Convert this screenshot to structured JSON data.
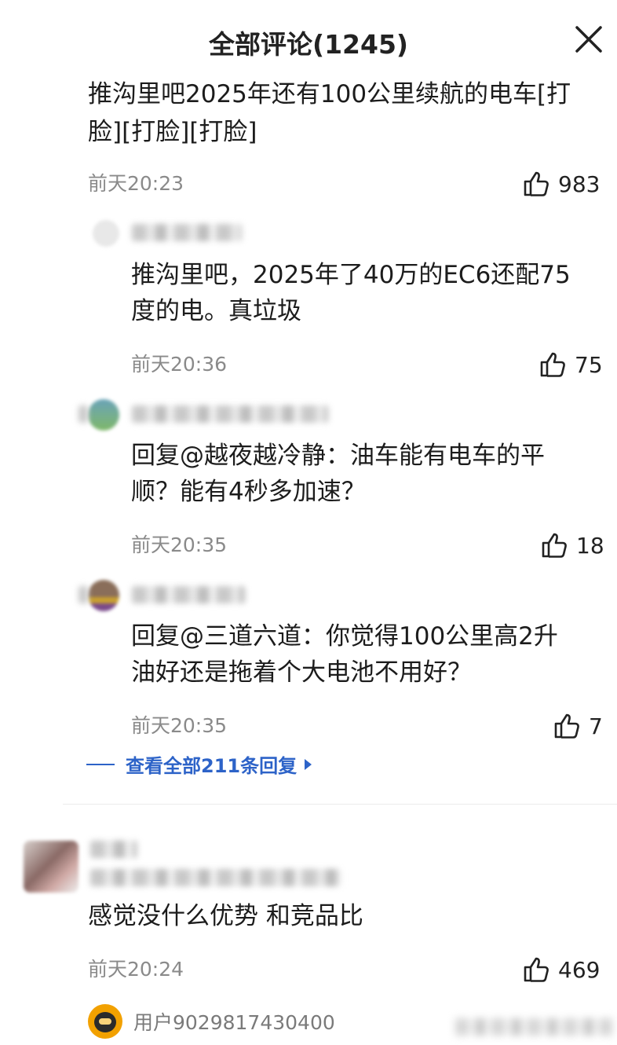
{
  "header": {
    "title": "全部评论(1245)"
  },
  "view_all": {
    "label": "查看全部211条回复"
  },
  "comments": [
    {
      "text_line1": "推沟里吧2025年还有100公里续航的电车[打",
      "text_line2": "脸][打脸][打脸]",
      "time": "前天20:23",
      "likes": "983",
      "replies": [
        {
          "text_line1": "推沟里吧，2025年了40万的EC6还配75",
          "text_line2": "度的电。真垃圾",
          "time": "前天20:36",
          "likes": "75"
        },
        {
          "text_line1": "回复@越夜越冷静：油车能有电车的平",
          "text_line2": "顺？能有4秒多加速？",
          "time": "前天20:35",
          "likes": "18"
        },
        {
          "text_line1": "回复@三道六道：你觉得100公里高2升",
          "text_line2": "油好还是拖着个大电池不用好？",
          "time": "前天20:35",
          "likes": "7"
        }
      ]
    },
    {
      "text_line1": "感觉没什么优势 和竞品比",
      "time": "前天20:24",
      "likes": "469",
      "preview_user": "用户9029817430400"
    }
  ]
}
